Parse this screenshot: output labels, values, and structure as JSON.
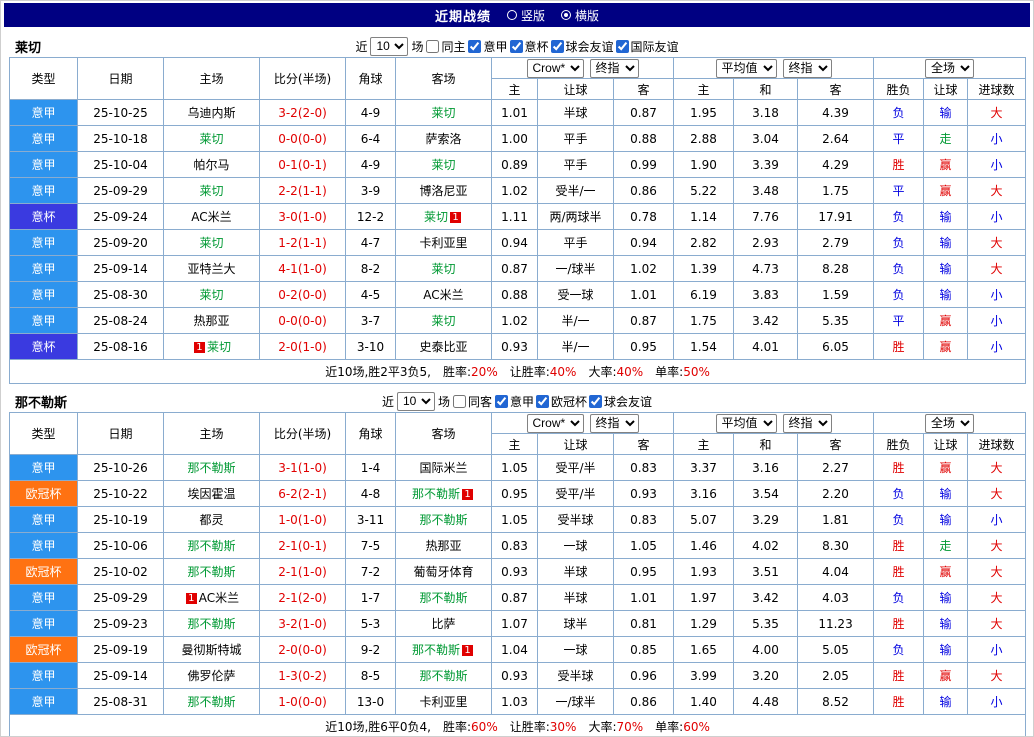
{
  "topbar": {
    "title": "近期战绩",
    "options": [
      {
        "label": "竖版",
        "selected": false
      },
      {
        "label": "横版",
        "selected": true
      }
    ]
  },
  "filter_bar": {
    "near": "近",
    "matches_value": "10",
    "matches_unit": "场",
    "bookmaker": "Crow*",
    "final_label": "终指",
    "average": "平均值",
    "fulltime": "全场"
  },
  "columns": {
    "type": "类型",
    "date": "日期",
    "home": "主场",
    "score": "比分(半场)",
    "corner": "角球",
    "away": "客场",
    "ah_home": "主",
    "ah_line": "让球",
    "ah_away": "客",
    "eu_home": "主",
    "eu_draw": "和",
    "eu_away": "客",
    "res_wdl": "胜负",
    "res_ah": "让球",
    "res_goal": "进球数"
  },
  "league_colors": {
    "意甲": "#2d94ee",
    "意杯": "#3a3ae0",
    "欧冠杯": "#ff7212"
  },
  "result_colors": {
    "胜": "#e00000",
    "平": "#0000e0",
    "负": "#0000e0",
    "赢": "#e00000",
    "走": "#009933",
    "输": "#0000e0",
    "大": "#e00000",
    "小": "#0000e0"
  },
  "sections": [
    {
      "team": "莱切",
      "same_filter": {
        "label": "同主",
        "checked": false
      },
      "league_filters": [
        {
          "label": "意甲",
          "checked": true
        },
        {
          "label": "意杯",
          "checked": true
        },
        {
          "label": "球会友谊",
          "checked": true
        },
        {
          "label": "国际友谊",
          "checked": true
        }
      ],
      "rows": [
        {
          "league": "意甲",
          "date": "25-10-25",
          "home": "乌迪内斯",
          "home_is_focus": false,
          "home_red_card": 0,
          "score": "3-2(2-0)",
          "corners": "4-9",
          "away": "莱切",
          "away_is_focus": true,
          "away_red_card": 0,
          "asian_odds": [
            "1.01",
            "半球",
            "0.87"
          ],
          "euro_odds": [
            "1.95",
            "3.18",
            "4.39"
          ],
          "results": [
            "负",
            "输",
            "大"
          ]
        },
        {
          "league": "意甲",
          "date": "25-10-18",
          "home": "莱切",
          "home_is_focus": true,
          "home_red_card": 0,
          "score": "0-0(0-0)",
          "corners": "6-4",
          "away": "萨索洛",
          "away_is_focus": false,
          "away_red_card": 0,
          "asian_odds": [
            "1.00",
            "平手",
            "0.88"
          ],
          "euro_odds": [
            "2.88",
            "3.04",
            "2.64"
          ],
          "results": [
            "平",
            "走",
            "小"
          ]
        },
        {
          "league": "意甲",
          "date": "25-10-04",
          "home": "帕尔马",
          "home_is_focus": false,
          "home_red_card": 0,
          "score": "0-1(0-1)",
          "corners": "4-9",
          "away": "莱切",
          "away_is_focus": true,
          "away_red_card": 0,
          "asian_odds": [
            "0.89",
            "平手",
            "0.99"
          ],
          "euro_odds": [
            "1.90",
            "3.39",
            "4.29"
          ],
          "results": [
            "胜",
            "赢",
            "小"
          ]
        },
        {
          "league": "意甲",
          "date": "25-09-29",
          "home": "莱切",
          "home_is_focus": true,
          "home_red_card": 0,
          "score": "2-2(1-1)",
          "corners": "3-9",
          "away": "博洛尼亚",
          "away_is_focus": false,
          "away_red_card": 0,
          "asian_odds": [
            "1.02",
            "受半/一",
            "0.86"
          ],
          "euro_odds": [
            "5.22",
            "3.48",
            "1.75"
          ],
          "results": [
            "平",
            "赢",
            "大"
          ]
        },
        {
          "league": "意杯",
          "date": "25-09-24",
          "home": "AC米兰",
          "home_is_focus": false,
          "home_red_card": 0,
          "score": "3-0(1-0)",
          "corners": "12-2",
          "away": "莱切",
          "away_is_focus": true,
          "away_red_card": 1,
          "asian_odds": [
            "1.11",
            "两/两球半",
            "0.78"
          ],
          "euro_odds": [
            "1.14",
            "7.76",
            "17.91"
          ],
          "results": [
            "负",
            "输",
            "小"
          ]
        },
        {
          "league": "意甲",
          "date": "25-09-20",
          "home": "莱切",
          "home_is_focus": true,
          "home_red_card": 0,
          "score": "1-2(1-1)",
          "corners": "4-7",
          "away": "卡利亚里",
          "away_is_focus": false,
          "away_red_card": 0,
          "asian_odds": [
            "0.94",
            "平手",
            "0.94"
          ],
          "euro_odds": [
            "2.82",
            "2.93",
            "2.79"
          ],
          "results": [
            "负",
            "输",
            "大"
          ]
        },
        {
          "league": "意甲",
          "date": "25-09-14",
          "home": "亚特兰大",
          "home_is_focus": false,
          "home_red_card": 0,
          "score": "4-1(1-0)",
          "corners": "8-2",
          "away": "莱切",
          "away_is_focus": true,
          "away_red_card": 0,
          "asian_odds": [
            "0.87",
            "一/球半",
            "1.02"
          ],
          "euro_odds": [
            "1.39",
            "4.73",
            "8.28"
          ],
          "results": [
            "负",
            "输",
            "大"
          ]
        },
        {
          "league": "意甲",
          "date": "25-08-30",
          "home": "莱切",
          "home_is_focus": true,
          "home_red_card": 0,
          "score": "0-2(0-0)",
          "corners": "4-5",
          "away": "AC米兰",
          "away_is_focus": false,
          "away_red_card": 0,
          "asian_odds": [
            "0.88",
            "受一球",
            "1.01"
          ],
          "euro_odds": [
            "6.19",
            "3.83",
            "1.59"
          ],
          "results": [
            "负",
            "输",
            "小"
          ]
        },
        {
          "league": "意甲",
          "date": "25-08-24",
          "home": "热那亚",
          "home_is_focus": false,
          "home_red_card": 0,
          "score": "0-0(0-0)",
          "corners": "3-7",
          "away": "莱切",
          "away_is_focus": true,
          "away_red_card": 0,
          "asian_odds": [
            "1.02",
            "半/一",
            "0.87"
          ],
          "euro_odds": [
            "1.75",
            "3.42",
            "5.35"
          ],
          "results": [
            "平",
            "赢",
            "小"
          ]
        },
        {
          "league": "意杯",
          "date": "25-08-16",
          "home": "莱切",
          "home_is_focus": true,
          "home_red_card": 1,
          "score": "2-0(1-0)",
          "corners": "3-10",
          "away": "史泰比亚",
          "away_is_focus": false,
          "away_red_card": 0,
          "asian_odds": [
            "0.93",
            "半/一",
            "0.95"
          ],
          "euro_odds": [
            "1.54",
            "4.01",
            "6.05"
          ],
          "results": [
            "胜",
            "赢",
            "小"
          ]
        }
      ],
      "summary": {
        "prefix": "近10场,胜2平3负5,",
        "stats": [
          {
            "label": "胜率:",
            "value": "20%"
          },
          {
            "label": "让胜率:",
            "value": "40%"
          },
          {
            "label": "大率:",
            "value": "40%"
          },
          {
            "label": "单率:",
            "value": "50%"
          }
        ]
      }
    },
    {
      "team": "那不勒斯",
      "same_filter": {
        "label": "同客",
        "checked": false
      },
      "league_filters": [
        {
          "label": "意甲",
          "checked": true
        },
        {
          "label": "欧冠杯",
          "checked": true
        },
        {
          "label": "球会友谊",
          "checked": true
        }
      ],
      "rows": [
        {
          "league": "意甲",
          "date": "25-10-26",
          "home": "那不勒斯",
          "home_is_focus": true,
          "home_red_card": 0,
          "score": "3-1(1-0)",
          "corners": "1-4",
          "away": "国际米兰",
          "away_is_focus": false,
          "away_red_card": 0,
          "asian_odds": [
            "1.05",
            "受平/半",
            "0.83"
          ],
          "euro_odds": [
            "3.37",
            "3.16",
            "2.27"
          ],
          "results": [
            "胜",
            "赢",
            "大"
          ]
        },
        {
          "league": "欧冠杯",
          "date": "25-10-22",
          "home": "埃因霍温",
          "home_is_focus": false,
          "home_red_card": 0,
          "score": "6-2(2-1)",
          "corners": "4-8",
          "away": "那不勒斯",
          "away_is_focus": true,
          "away_red_card": 1,
          "asian_odds": [
            "0.95",
            "受平/半",
            "0.93"
          ],
          "euro_odds": [
            "3.16",
            "3.54",
            "2.20"
          ],
          "results": [
            "负",
            "输",
            "大"
          ]
        },
        {
          "league": "意甲",
          "date": "25-10-19",
          "home": "都灵",
          "home_is_focus": false,
          "home_red_card": 0,
          "score": "1-0(1-0)",
          "corners": "3-11",
          "away": "那不勒斯",
          "away_is_focus": true,
          "away_red_card": 0,
          "asian_odds": [
            "1.05",
            "受半球",
            "0.83"
          ],
          "euro_odds": [
            "5.07",
            "3.29",
            "1.81"
          ],
          "results": [
            "负",
            "输",
            "小"
          ]
        },
        {
          "league": "意甲",
          "date": "25-10-06",
          "home": "那不勒斯",
          "home_is_focus": true,
          "home_red_card": 0,
          "score": "2-1(0-1)",
          "corners": "7-5",
          "away": "热那亚",
          "away_is_focus": false,
          "away_red_card": 0,
          "asian_odds": [
            "0.83",
            "一球",
            "1.05"
          ],
          "euro_odds": [
            "1.46",
            "4.02",
            "8.30"
          ],
          "results": [
            "胜",
            "走",
            "大"
          ]
        },
        {
          "league": "欧冠杯",
          "date": "25-10-02",
          "home": "那不勒斯",
          "home_is_focus": true,
          "home_red_card": 0,
          "score": "2-1(1-0)",
          "corners": "7-2",
          "away": "葡萄牙体育",
          "away_is_focus": false,
          "away_red_card": 0,
          "asian_odds": [
            "0.93",
            "半球",
            "0.95"
          ],
          "euro_odds": [
            "1.93",
            "3.51",
            "4.04"
          ],
          "results": [
            "胜",
            "赢",
            "大"
          ]
        },
        {
          "league": "意甲",
          "date": "25-09-29",
          "home": "AC米兰",
          "home_is_focus": false,
          "home_red_card": 1,
          "score": "2-1(2-0)",
          "corners": "1-7",
          "away": "那不勒斯",
          "away_is_focus": true,
          "away_red_card": 0,
          "asian_odds": [
            "0.87",
            "半球",
            "1.01"
          ],
          "euro_odds": [
            "1.97",
            "3.42",
            "4.03"
          ],
          "results": [
            "负",
            "输",
            "大"
          ]
        },
        {
          "league": "意甲",
          "date": "25-09-23",
          "home": "那不勒斯",
          "home_is_focus": true,
          "home_red_card": 0,
          "score": "3-2(1-0)",
          "corners": "5-3",
          "away": "比萨",
          "away_is_focus": false,
          "away_red_card": 0,
          "asian_odds": [
            "1.07",
            "球半",
            "0.81"
          ],
          "euro_odds": [
            "1.29",
            "5.35",
            "11.23"
          ],
          "results": [
            "胜",
            "输",
            "大"
          ]
        },
        {
          "league": "欧冠杯",
          "date": "25-09-19",
          "home": "曼彻斯特城",
          "home_is_focus": false,
          "home_red_card": 0,
          "score": "2-0(0-0)",
          "corners": "9-2",
          "away": "那不勒斯",
          "away_is_focus": true,
          "away_red_card": 1,
          "asian_odds": [
            "1.04",
            "一球",
            "0.85"
          ],
          "euro_odds": [
            "1.65",
            "4.00",
            "5.05"
          ],
          "results": [
            "负",
            "输",
            "小"
          ]
        },
        {
          "league": "意甲",
          "date": "25-09-14",
          "home": "佛罗伦萨",
          "home_is_focus": false,
          "home_red_card": 0,
          "score": "1-3(0-2)",
          "corners": "8-5",
          "away": "那不勒斯",
          "away_is_focus": true,
          "away_red_card": 0,
          "asian_odds": [
            "0.93",
            "受半球",
            "0.96"
          ],
          "euro_odds": [
            "3.99",
            "3.20",
            "2.05"
          ],
          "results": [
            "胜",
            "赢",
            "大"
          ]
        },
        {
          "league": "意甲",
          "date": "25-08-31",
          "home": "那不勒斯",
          "home_is_focus": true,
          "home_red_card": 0,
          "score": "1-0(0-0)",
          "corners": "13-0",
          "away": "卡利亚里",
          "away_is_focus": false,
          "away_red_card": 0,
          "asian_odds": [
            "1.03",
            "一/球半",
            "0.86"
          ],
          "euro_odds": [
            "1.40",
            "4.48",
            "8.52"
          ],
          "results": [
            "胜",
            "输",
            "小"
          ]
        }
      ],
      "summary": {
        "prefix": "近10场,胜6平0负4,",
        "stats": [
          {
            "label": "胜率:",
            "value": "60%"
          },
          {
            "label": "让胜率:",
            "value": "30%"
          },
          {
            "label": "大率:",
            "value": "70%"
          },
          {
            "label": "单率:",
            "value": "60%"
          }
        ]
      }
    }
  ]
}
